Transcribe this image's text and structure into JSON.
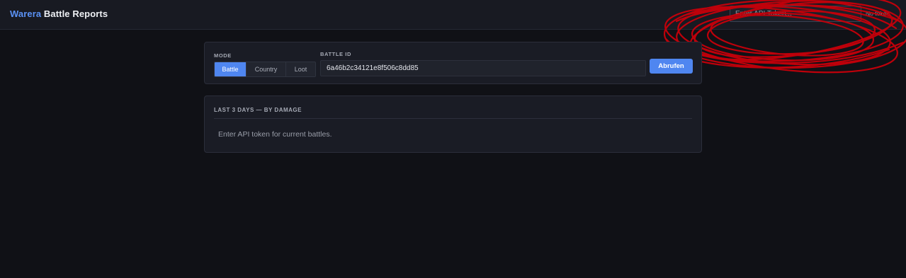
{
  "header": {
    "brand_accent": "Warera",
    "brand_rest": "Battle Reports",
    "token_placeholder": "Enter API Token...",
    "token_status": "No token"
  },
  "controls": {
    "mode_label": "MODE",
    "modes": [
      "Battle",
      "Country",
      "Loot"
    ],
    "active_mode": "Battle",
    "battle_id_label": "BATTLE ID",
    "battle_id_value": "6a46b2c34121e8f506c8dd85",
    "fetch_label": "Abrufen"
  },
  "recent": {
    "title": "LAST 3 DAYS — BY DAMAGE",
    "empty_message": "Enter API token for current battles."
  },
  "colors": {
    "accent": "#4f86f0",
    "background": "#101116",
    "card": "#1a1c25",
    "annotation": "#c8000a"
  }
}
